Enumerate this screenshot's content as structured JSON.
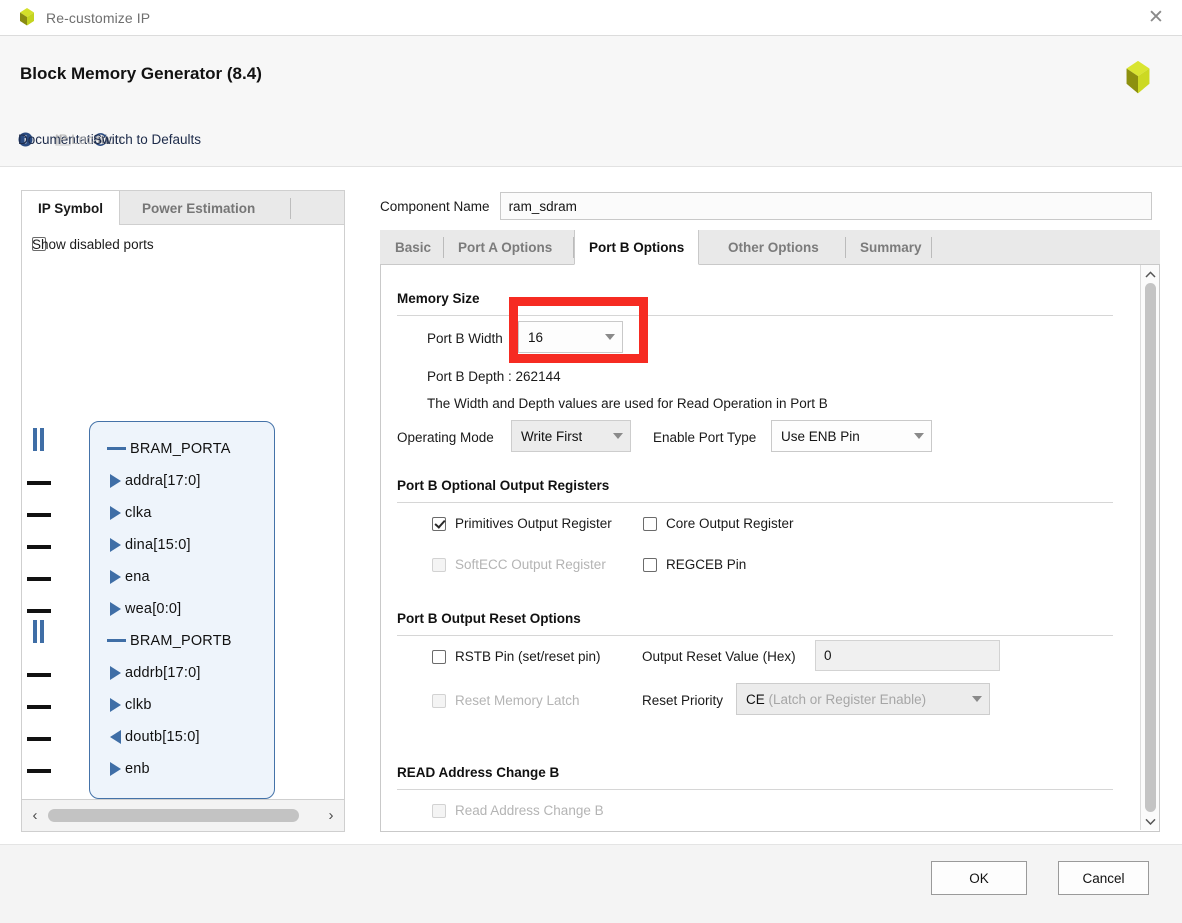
{
  "window": {
    "title": "Re-customize IP",
    "close_label": "✕"
  },
  "header": {
    "title": "Block Memory Generator (8.4)",
    "toolbar": [
      {
        "label": "Documentation",
        "icon": "info-icon",
        "disabled": false
      },
      {
        "label": "IP Location",
        "icon": "folder-icon",
        "disabled": true
      },
      {
        "label": "Switch to Defaults",
        "icon": "refresh-icon",
        "disabled": false
      }
    ]
  },
  "left_panel": {
    "tabs": [
      {
        "label": "IP Symbol",
        "active": true
      },
      {
        "label": "Power Estimation",
        "active": false
      }
    ],
    "show_disabled_ports": {
      "label": "Show disabled ports",
      "checked": false
    },
    "symbol": {
      "ports": [
        {
          "name": "BRAM_PORTA",
          "kind": "bus"
        },
        {
          "name": "addra[17:0]",
          "kind": "in"
        },
        {
          "name": "clka",
          "kind": "in"
        },
        {
          "name": "dina[15:0]",
          "kind": "in"
        },
        {
          "name": "ena",
          "kind": "in"
        },
        {
          "name": "wea[0:0]",
          "kind": "in"
        },
        {
          "name": "BRAM_PORTB",
          "kind": "bus"
        },
        {
          "name": "addrb[17:0]",
          "kind": "in"
        },
        {
          "name": "clkb",
          "kind": "in"
        },
        {
          "name": "doutb[15:0]",
          "kind": "out"
        },
        {
          "name": "enb",
          "kind": "in"
        }
      ]
    },
    "hscroll": {
      "left_arrow": "‹",
      "right_arrow": "›"
    }
  },
  "component_name": {
    "label": "Component Name",
    "value": "ram_sdram"
  },
  "tabs": [
    {
      "label": "Basic",
      "active": false
    },
    {
      "label": "Port A Options",
      "active": false
    },
    {
      "label": "Port B Options",
      "active": true
    },
    {
      "label": "Other Options",
      "active": false
    },
    {
      "label": "Summary",
      "active": false
    }
  ],
  "port_b": {
    "memory_size": {
      "section": "Memory Size",
      "width_label": "Port B Width",
      "width_value": "16",
      "depth_text": "Port B Depth : 262144",
      "note": "The Width and Depth values are used for Read Operation in Port B"
    },
    "operating_mode": {
      "label": "Operating Mode",
      "value": "Write First",
      "disabled": true
    },
    "enable_port_type": {
      "label": "Enable Port Type",
      "value": "Use ENB Pin",
      "disabled": false
    },
    "optional_output_registers": {
      "section": "Port B Optional Output Registers",
      "items": [
        {
          "label": "Primitives Output Register",
          "checked": true,
          "disabled": false
        },
        {
          "label": "Core Output Register",
          "checked": false,
          "disabled": false
        },
        {
          "label": "SoftECC Output Register",
          "checked": false,
          "disabled": true
        },
        {
          "label": "REGCEB Pin",
          "checked": false,
          "disabled": false
        }
      ]
    },
    "output_reset_options": {
      "section": "Port B Output Reset Options",
      "rstb": {
        "label": "RSTB Pin (set/reset pin)",
        "checked": false,
        "disabled": false
      },
      "reset_memory_latch": {
        "label": "Reset Memory Latch",
        "checked": false,
        "disabled": true
      },
      "output_reset_value": {
        "label": "Output Reset Value (Hex)",
        "value": "0"
      },
      "reset_priority": {
        "label": "Reset Priority",
        "value_strong": "CE",
        "value_dim": "(Latch or Register Enable)",
        "disabled": true
      }
    },
    "read_address_change": {
      "section": "READ Address Change B",
      "checkbox": {
        "label": "Read Address Change B",
        "checked": false,
        "disabled": true
      }
    }
  },
  "scrollbars": {
    "up_arrow": "▲",
    "down_arrow": "▼"
  },
  "footer": {
    "ok": "OK",
    "cancel": "Cancel"
  },
  "highlight": {
    "color": "#f62b22",
    "target": "Port B Width dropdown"
  }
}
